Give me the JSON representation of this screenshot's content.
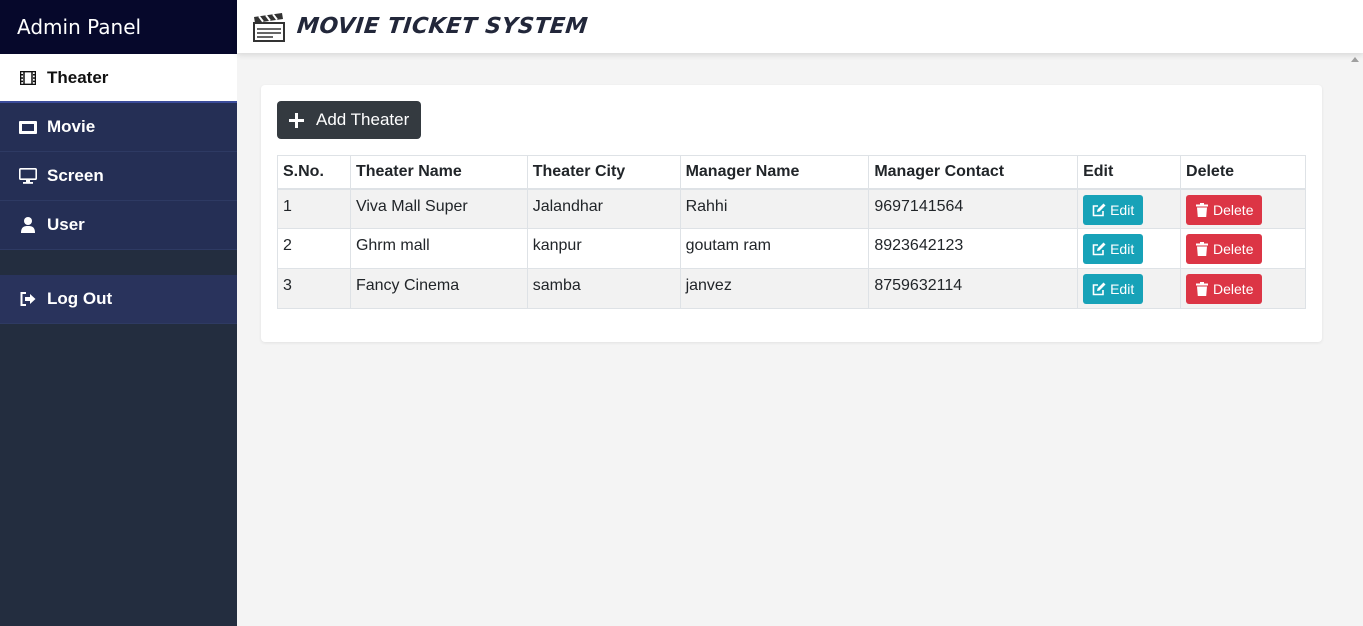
{
  "sidebar": {
    "brand": "Admin Panel",
    "items": [
      {
        "label": "Theater",
        "icon": "film-icon",
        "active": true
      },
      {
        "label": "Movie",
        "icon": "ticket-icon",
        "active": false
      },
      {
        "label": "Screen",
        "icon": "desktop-icon",
        "active": false
      },
      {
        "label": "User",
        "icon": "user-icon",
        "active": false
      }
    ],
    "logout": {
      "label": "Log Out",
      "icon": "sign-out-icon"
    }
  },
  "header": {
    "title": "MOVIE TICKET SYSTEM",
    "logo_icon": "clapperboard-icon"
  },
  "main": {
    "add_button_label": "Add Theater",
    "table": {
      "columns": [
        "S.No.",
        "Theater Name",
        "Theater City",
        "Manager Name",
        "Manager Contact",
        "Edit",
        "Delete"
      ],
      "rows": [
        {
          "sno": "1",
          "name": "Viva Mall Super",
          "city": "Jalandhar",
          "manager": "Rahhi",
          "contact": "9697141564"
        },
        {
          "sno": "2",
          "name": "Ghrm mall",
          "city": "kanpur",
          "manager": "goutam ram",
          "contact": "8923642123"
        },
        {
          "sno": "3",
          "name": "Fancy Cinema",
          "city": "samba",
          "manager": "janvez",
          "contact": "8759632114"
        }
      ],
      "edit_label": "Edit",
      "delete_label": "Delete"
    }
  },
  "colors": {
    "sidebar_brand_bg": "#06082b",
    "sidebar_bg": "#232d3f",
    "nav_bg": "#252f55",
    "edit": "#17a2b8",
    "delete": "#dc3545",
    "add_button": "#343a40"
  }
}
